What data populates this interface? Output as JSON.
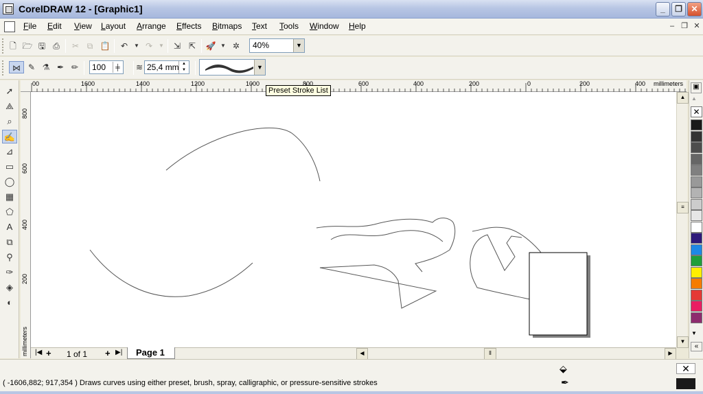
{
  "window": {
    "title": "CorelDRAW 12 - [Graphic1]",
    "controls": [
      "_",
      "❐",
      "✕"
    ]
  },
  "menu": {
    "items": [
      {
        "label": "File",
        "ul": "F",
        "rest": "ile"
      },
      {
        "label": "Edit",
        "ul": "E",
        "rest": "dit"
      },
      {
        "label": "View",
        "ul": "V",
        "rest": "iew"
      },
      {
        "label": "Layout",
        "ul": "L",
        "rest": "ayout"
      },
      {
        "label": "Arrange",
        "ul": "A",
        "rest": "rrange"
      },
      {
        "label": "Effects",
        "ul": "E",
        "rest": "ffects",
        "pre": ""
      },
      {
        "label": "Bitmaps",
        "ul": "B",
        "rest": "itmaps"
      },
      {
        "label": "Text",
        "ul": "T",
        "rest": "ext"
      },
      {
        "label": "Tools",
        "ul": "T",
        "rest": "ools"
      },
      {
        "label": "Window",
        "ul": "W",
        "rest": "indow"
      },
      {
        "label": "Help",
        "ul": "H",
        "rest": "elp"
      }
    ],
    "doc_controls": [
      "–",
      "❐",
      "✕"
    ]
  },
  "toolbar": {
    "zoom": "40%",
    "smoothing": "100",
    "stroke_width": "25,4 mm",
    "tooltip": "Preset Stroke List"
  },
  "rulers": {
    "units": "millimeters",
    "h_ticks": [
      "00",
      "1600",
      "1400",
      "1200",
      "1000",
      "800",
      "600",
      "400",
      "200",
      "0",
      "200",
      "400"
    ],
    "v_ticks": [
      "800",
      "600",
      "400",
      "200"
    ]
  },
  "pages": {
    "counter": "1 of 1",
    "tab": "Page 1"
  },
  "status": {
    "text": "( -1606,882; 917,354 ) Draws curves using either preset, brush, spray, calligraphic, or pressure-sensitive strokes"
  },
  "palette": {
    "colors": [
      "#1a1a1a",
      "#333333",
      "#4d4d4d",
      "#666666",
      "#808080",
      "#999999",
      "#b3b3b3",
      "#cccccc",
      "#e6e6e6",
      "#ffffff",
      "#2e1a7a",
      "#1e88e5",
      "#1f9e3a",
      "#ffef00",
      "#f57c00",
      "#e53935",
      "#e91e63",
      "#8e2b6e"
    ]
  },
  "toolbox": {
    "tools": [
      "pick-tool",
      "shape-tool",
      "zoom-tool",
      "artistic-media-tool",
      "dimension-tool",
      "rectangle-tool",
      "ellipse-tool",
      "graph-paper-tool",
      "basic-shapes-tool",
      "text-tool",
      "interactive-blend-tool",
      "eyedropper-tool",
      "outline-tool",
      "fill-tool",
      "interactive-fill-tool"
    ],
    "active": "artistic-media-tool"
  }
}
